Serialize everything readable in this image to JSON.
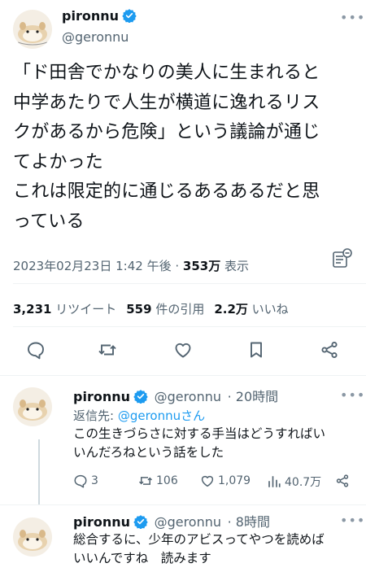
{
  "main_tweet": {
    "display_name": "pironnu",
    "handle": "@geronnu",
    "text_lines": [
      "「ド田舎でかなりの美人に生まれると",
      "中学あたりで人生が横道に逸れるリス",
      "クがあるから危険」という議論が通じ",
      "てよかった",
      "これは限定的に通じるあるあるだと思",
      "っている"
    ],
    "timestamp": "2023年02月23日 1:42 午後",
    "separator": " · ",
    "views_count": "353万",
    "views_label": " 表示",
    "stats": {
      "retweets_count": "3,231",
      "retweets_label": " リツイート",
      "quotes_count": "559",
      "quotes_label": " 件の引用",
      "likes_count": "2.2万",
      "likes_label": " いいね"
    }
  },
  "replies": [
    {
      "display_name": "pironnu",
      "handle": "@geronnu",
      "time": "· 20時間",
      "reply_to_label": "返信先: ",
      "reply_to_handle": "@geronnuさん",
      "text_lines": [
        "この生きづらさに対する手当はどうすればい",
        "いんだろねという話をした"
      ],
      "actions": {
        "replies": "3",
        "retweets": "106",
        "likes": "1,079",
        "views": "40.7万"
      }
    },
    {
      "display_name": "pironnu",
      "handle": "@geronnu",
      "time": "· 8時間",
      "text_lines": [
        "総合するに、少年のアビスってやつを読めば",
        "いいんですね　読みます"
      ]
    }
  ],
  "colors": {
    "verified": "#1d9bf0",
    "secondary_text": "#536471",
    "link": "#1d9bf0",
    "icon": "#536471"
  }
}
